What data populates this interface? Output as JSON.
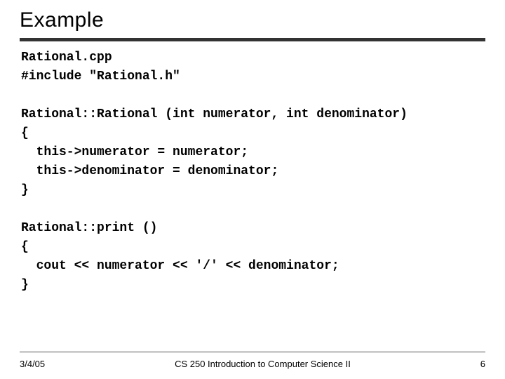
{
  "title": "Example",
  "code": "Rational.cpp\n#include \"Rational.h\"\n\nRational::Rational (int numerator, int denominator)\n{\n  this->numerator = numerator;\n  this->denominator = denominator;\n}\n\nRational::print ()\n{\n  cout << numerator << '/' << denominator;\n}",
  "footer": {
    "date": "3/4/05",
    "course": "CS 250 Introduction to Computer Science II",
    "page": "6"
  }
}
